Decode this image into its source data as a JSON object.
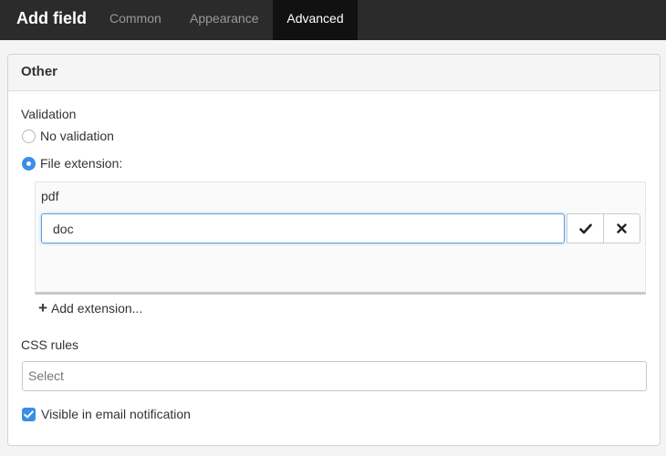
{
  "header": {
    "title": "Add field",
    "tabs": [
      {
        "label": "Common",
        "active": false
      },
      {
        "label": "Appearance",
        "active": false
      },
      {
        "label": "Advanced",
        "active": true
      }
    ]
  },
  "panel": {
    "title": "Other",
    "validation": {
      "label": "Validation",
      "options": [
        {
          "label": "No validation",
          "checked": false
        },
        {
          "label": "File extension:",
          "checked": true
        }
      ]
    },
    "extensions": {
      "items": [
        "pdf"
      ],
      "input_value": "doc",
      "confirm_icon": "check-icon",
      "cancel_icon": "close-icon",
      "add_label": "Add extension..."
    },
    "css_rules": {
      "label": "CSS rules",
      "placeholder": "Select"
    },
    "email_visibility": {
      "label": "Visible in email notification",
      "checked": true
    }
  },
  "colors": {
    "topbar": "#2b2b2b",
    "active_tab": "#111111",
    "accent": "#3a8ee6"
  }
}
